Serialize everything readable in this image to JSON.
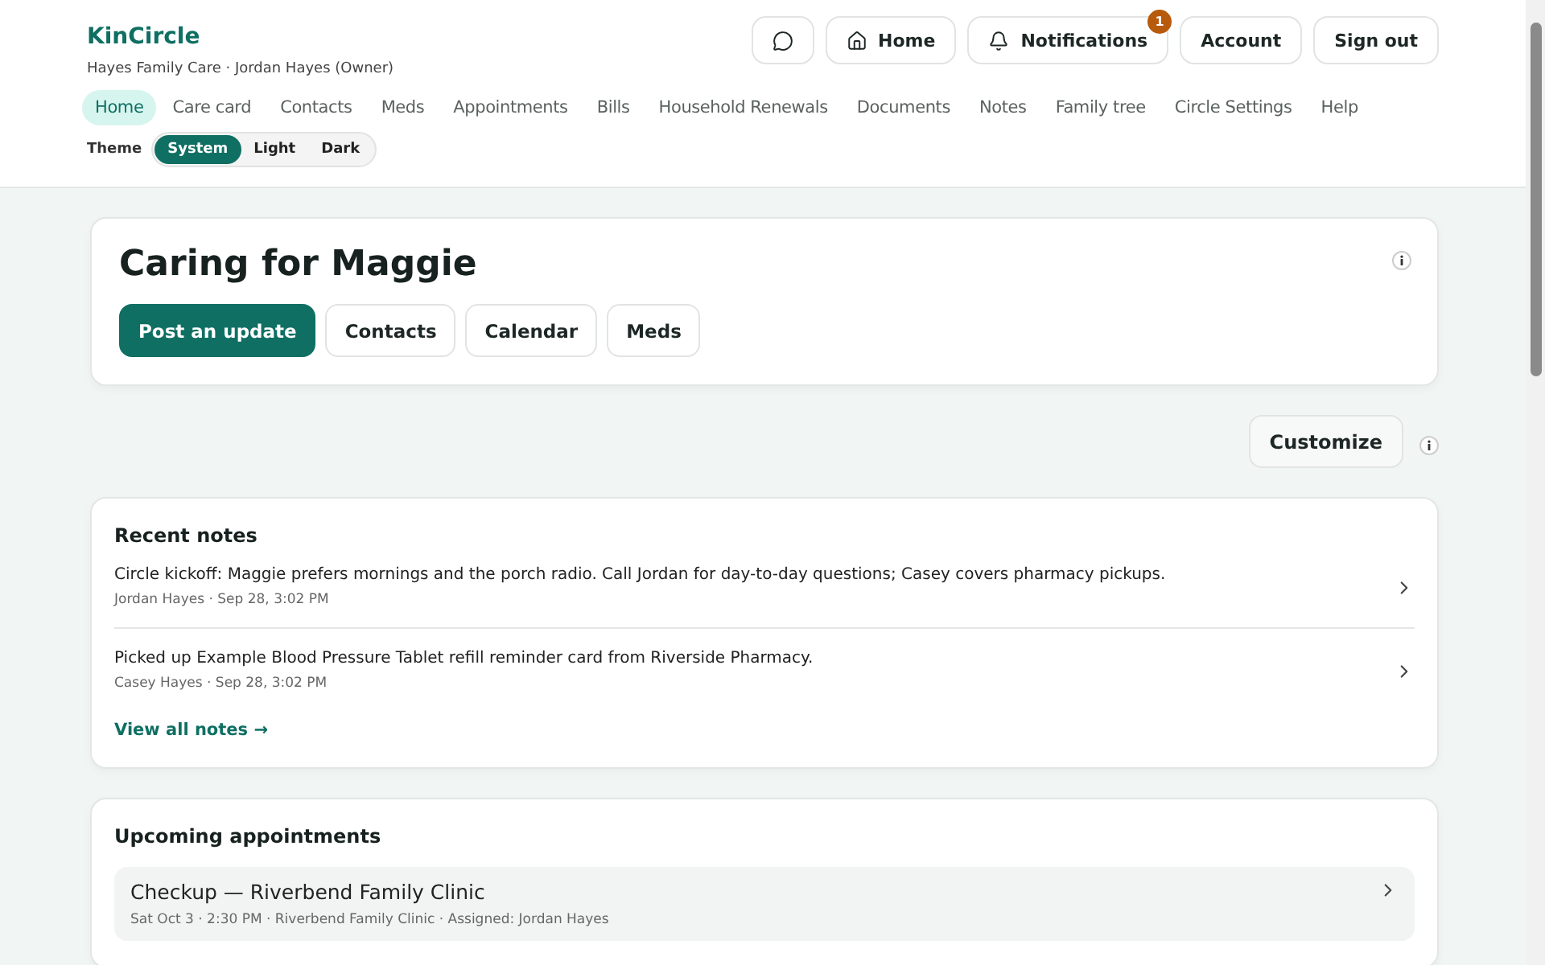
{
  "header": {
    "brand": "KinCircle",
    "subtitle": "Hayes Family Care · Jordan Hayes (Owner)",
    "actions": [
      {
        "kind": "icon"
      },
      {
        "kind": "home",
        "label": "Home"
      },
      {
        "kind": "bell",
        "label": "Notifications",
        "badge": "1"
      },
      {
        "kind": "text",
        "label": "Account"
      },
      {
        "kind": "text",
        "label": "Sign out"
      }
    ]
  },
  "nav": [
    {
      "label": "Home",
      "selected": true
    },
    {
      "label": "Care card",
      "selected": false
    },
    {
      "label": "Contacts",
      "selected": false
    },
    {
      "label": "Meds",
      "selected": false
    },
    {
      "label": "Appointments",
      "selected": false
    },
    {
      "label": "Bills",
      "selected": false
    },
    {
      "label": "Household Renewals",
      "selected": false
    },
    {
      "label": "Documents",
      "selected": false
    },
    {
      "label": "Notes",
      "selected": false
    },
    {
      "label": "Family tree",
      "selected": false
    },
    {
      "label": "Circle Settings",
      "selected": false
    },
    {
      "label": "Help",
      "selected": false
    }
  ],
  "theme": {
    "label": "Theme",
    "options": [
      {
        "label": "System",
        "selected": true
      },
      {
        "label": "Light",
        "selected": false
      },
      {
        "label": "Dark",
        "selected": false
      }
    ]
  },
  "hero": {
    "title": "Caring for Maggie",
    "buttons": [
      {
        "label": "Post an update",
        "primary": true
      },
      {
        "label": "Contacts",
        "primary": false
      },
      {
        "label": "Calendar",
        "primary": false
      },
      {
        "label": "Meds",
        "primary": false
      }
    ]
  },
  "customize": "Customize",
  "recent_notes": {
    "title": "Recent notes",
    "items": [
      {
        "text": "Circle kickoff: Maggie prefers mornings and the porch radio. Call Jordan for day-to-day questions; Casey covers pharmacy pickups.",
        "meta": "Jordan Hayes · Sep 28, 3:02 PM"
      },
      {
        "text": "Picked up Example Blood Pressure Tablet refill reminder card from Riverside Pharmacy.",
        "meta": "Casey Hayes · Sep 28, 3:02 PM"
      }
    ],
    "link": "View all notes →"
  },
  "appointments": {
    "title": "Upcoming appointments",
    "items": [
      {
        "title": "Checkup — Riverbend Family Clinic",
        "meta": "Sat Oct 3 · 2:30 PM · Riverbend Family Clinic · Assigned: Jordan Hayes"
      }
    ]
  }
}
